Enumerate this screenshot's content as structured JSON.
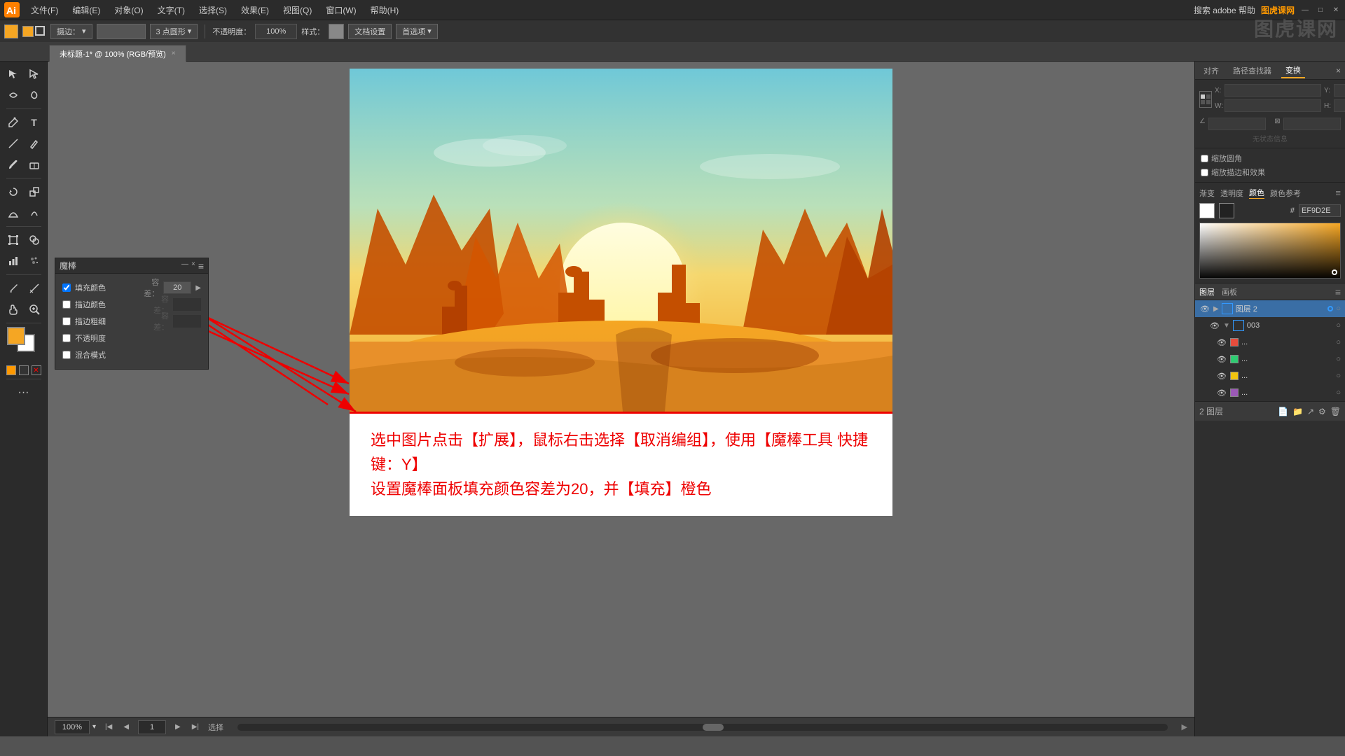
{
  "app": {
    "title": "Adobe Illustrator",
    "logo": "Ai"
  },
  "menubar": {
    "items": [
      "文件(F)",
      "编辑(E)",
      "对象(O)",
      "文字(T)",
      "选择(S)",
      "效果(E)",
      "视图(Q)",
      "窗口(W)",
      "帮助(H)"
    ],
    "search_placeholder": "搜索 adobe 帮助",
    "brand": "图虎课网",
    "window_buttons": [
      "—",
      "□",
      "×"
    ]
  },
  "toolbar": {
    "stroke_label": "描边：",
    "blend_label": "摄边：",
    "opacity_label": "不透明度：",
    "opacity_value": "100%",
    "style_label": "样式：",
    "doc_settings": "文档设置",
    "preferences": "首选项",
    "point_label": "3 点圆形"
  },
  "tab": {
    "name": "未标题-1*",
    "mode": "100% (RGB/预览)",
    "close": "×"
  },
  "magic_wand_panel": {
    "title": "魔棒",
    "fill_color": "填充颜色",
    "stroke_color": "描边颜色",
    "stroke_weight": "描边粗细",
    "opacity": "不透明度",
    "blend_mode": "混合模式",
    "tolerance_label": "容差：",
    "tolerance_value": "20",
    "tolerance_value_gray1": "容差：",
    "tolerance_value_gray2": "容差：",
    "opacity_val_gray": "",
    "blend_val_gray": ""
  },
  "instruction": {
    "line1": "选中图片点击【扩展】，鼠标右击选择【取消编组】，使用【魔棒工具 快捷键：Y】",
    "line2": "设置魔棒面板填充颜色容差为20，并【填充】橙色"
  },
  "right_panel": {
    "tabs": [
      "对齐",
      "路径查找器",
      "变换"
    ],
    "active_tab": "变换",
    "no_status": "无状态信息",
    "checkboxes": {
      "scale_corners": "缩放圆角",
      "scale_stroke": "缩放描边和效果"
    },
    "sliders": [
      "渐变",
      "透明度",
      "颜色",
      "颜色参考"
    ],
    "color_hex": "EF9D2E",
    "color_swatches": [
      "white",
      "black"
    ]
  },
  "layers_panel": {
    "tabs": [
      "图层",
      "画板"
    ],
    "active_tab": "图层",
    "layers": [
      {
        "name": "图层 2",
        "expanded": true,
        "color": "#3399ff",
        "active": true
      },
      {
        "name": "003",
        "expanded": false,
        "color": "#3399ff"
      },
      {
        "name": "...",
        "color": "#e74c3c"
      },
      {
        "name": "...",
        "color": "#2ecc71"
      },
      {
        "name": "...",
        "color": "#f1c40f"
      },
      {
        "name": "...",
        "color": "#9b59b6"
      }
    ],
    "bottom_label": "2 图层"
  },
  "statusbar": {
    "zoom": "100%",
    "page": "1",
    "action": "选择"
  },
  "canvas": {
    "zoom": "100%"
  }
}
